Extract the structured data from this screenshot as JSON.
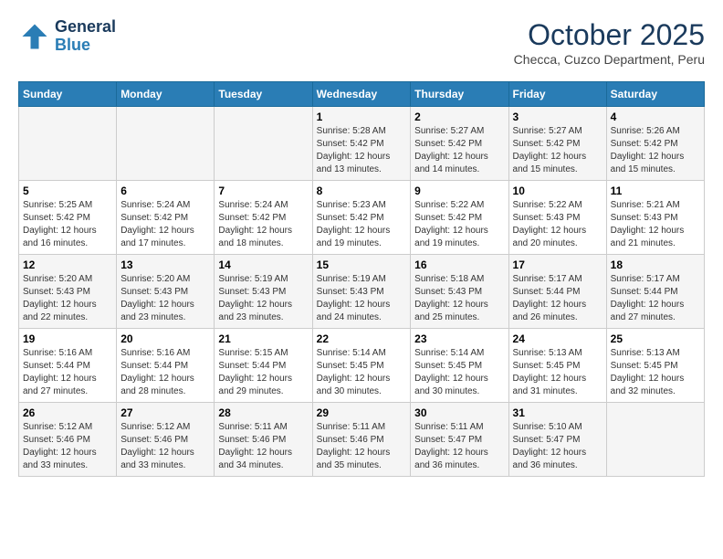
{
  "header": {
    "logo_line1": "General",
    "logo_line2": "Blue",
    "month": "October 2025",
    "location": "Checca, Cuzco Department, Peru"
  },
  "weekdays": [
    "Sunday",
    "Monday",
    "Tuesday",
    "Wednesday",
    "Thursday",
    "Friday",
    "Saturday"
  ],
  "weeks": [
    [
      {
        "day": "",
        "info": ""
      },
      {
        "day": "",
        "info": ""
      },
      {
        "day": "",
        "info": ""
      },
      {
        "day": "1",
        "info": "Sunrise: 5:28 AM\nSunset: 5:42 PM\nDaylight: 12 hours and 13 minutes."
      },
      {
        "day": "2",
        "info": "Sunrise: 5:27 AM\nSunset: 5:42 PM\nDaylight: 12 hours and 14 minutes."
      },
      {
        "day": "3",
        "info": "Sunrise: 5:27 AM\nSunset: 5:42 PM\nDaylight: 12 hours and 15 minutes."
      },
      {
        "day": "4",
        "info": "Sunrise: 5:26 AM\nSunset: 5:42 PM\nDaylight: 12 hours and 15 minutes."
      }
    ],
    [
      {
        "day": "5",
        "info": "Sunrise: 5:25 AM\nSunset: 5:42 PM\nDaylight: 12 hours and 16 minutes."
      },
      {
        "day": "6",
        "info": "Sunrise: 5:24 AM\nSunset: 5:42 PM\nDaylight: 12 hours and 17 minutes."
      },
      {
        "day": "7",
        "info": "Sunrise: 5:24 AM\nSunset: 5:42 PM\nDaylight: 12 hours and 18 minutes."
      },
      {
        "day": "8",
        "info": "Sunrise: 5:23 AM\nSunset: 5:42 PM\nDaylight: 12 hours and 19 minutes."
      },
      {
        "day": "9",
        "info": "Sunrise: 5:22 AM\nSunset: 5:42 PM\nDaylight: 12 hours and 19 minutes."
      },
      {
        "day": "10",
        "info": "Sunrise: 5:22 AM\nSunset: 5:43 PM\nDaylight: 12 hours and 20 minutes."
      },
      {
        "day": "11",
        "info": "Sunrise: 5:21 AM\nSunset: 5:43 PM\nDaylight: 12 hours and 21 minutes."
      }
    ],
    [
      {
        "day": "12",
        "info": "Sunrise: 5:20 AM\nSunset: 5:43 PM\nDaylight: 12 hours and 22 minutes."
      },
      {
        "day": "13",
        "info": "Sunrise: 5:20 AM\nSunset: 5:43 PM\nDaylight: 12 hours and 23 minutes."
      },
      {
        "day": "14",
        "info": "Sunrise: 5:19 AM\nSunset: 5:43 PM\nDaylight: 12 hours and 23 minutes."
      },
      {
        "day": "15",
        "info": "Sunrise: 5:19 AM\nSunset: 5:43 PM\nDaylight: 12 hours and 24 minutes."
      },
      {
        "day": "16",
        "info": "Sunrise: 5:18 AM\nSunset: 5:43 PM\nDaylight: 12 hours and 25 minutes."
      },
      {
        "day": "17",
        "info": "Sunrise: 5:17 AM\nSunset: 5:44 PM\nDaylight: 12 hours and 26 minutes."
      },
      {
        "day": "18",
        "info": "Sunrise: 5:17 AM\nSunset: 5:44 PM\nDaylight: 12 hours and 27 minutes."
      }
    ],
    [
      {
        "day": "19",
        "info": "Sunrise: 5:16 AM\nSunset: 5:44 PM\nDaylight: 12 hours and 27 minutes."
      },
      {
        "day": "20",
        "info": "Sunrise: 5:16 AM\nSunset: 5:44 PM\nDaylight: 12 hours and 28 minutes."
      },
      {
        "day": "21",
        "info": "Sunrise: 5:15 AM\nSunset: 5:44 PM\nDaylight: 12 hours and 29 minutes."
      },
      {
        "day": "22",
        "info": "Sunrise: 5:14 AM\nSunset: 5:45 PM\nDaylight: 12 hours and 30 minutes."
      },
      {
        "day": "23",
        "info": "Sunrise: 5:14 AM\nSunset: 5:45 PM\nDaylight: 12 hours and 30 minutes."
      },
      {
        "day": "24",
        "info": "Sunrise: 5:13 AM\nSunset: 5:45 PM\nDaylight: 12 hours and 31 minutes."
      },
      {
        "day": "25",
        "info": "Sunrise: 5:13 AM\nSunset: 5:45 PM\nDaylight: 12 hours and 32 minutes."
      }
    ],
    [
      {
        "day": "26",
        "info": "Sunrise: 5:12 AM\nSunset: 5:46 PM\nDaylight: 12 hours and 33 minutes."
      },
      {
        "day": "27",
        "info": "Sunrise: 5:12 AM\nSunset: 5:46 PM\nDaylight: 12 hours and 33 minutes."
      },
      {
        "day": "28",
        "info": "Sunrise: 5:11 AM\nSunset: 5:46 PM\nDaylight: 12 hours and 34 minutes."
      },
      {
        "day": "29",
        "info": "Sunrise: 5:11 AM\nSunset: 5:46 PM\nDaylight: 12 hours and 35 minutes."
      },
      {
        "day": "30",
        "info": "Sunrise: 5:11 AM\nSunset: 5:47 PM\nDaylight: 12 hours and 36 minutes."
      },
      {
        "day": "31",
        "info": "Sunrise: 5:10 AM\nSunset: 5:47 PM\nDaylight: 12 hours and 36 minutes."
      },
      {
        "day": "",
        "info": ""
      }
    ]
  ]
}
